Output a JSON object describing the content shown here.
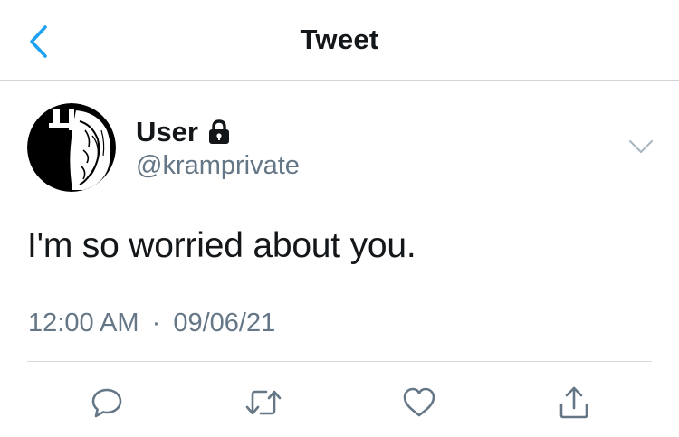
{
  "nav": {
    "title": "Tweet",
    "back_icon": "chevron-left-icon",
    "accent_color": "#1da1f2"
  },
  "tweet": {
    "author": {
      "name": "User",
      "handle": "@kramprivate",
      "protected_icon": "lock-icon",
      "avatar": "avatar-image"
    },
    "menu_icon": "chevron-down-icon",
    "text": "I'm so worried about you.",
    "time": "12:00 AM",
    "separator": "·",
    "date": "09/06/21"
  },
  "actions": [
    {
      "icon": "reply-icon"
    },
    {
      "icon": "retweet-icon"
    },
    {
      "icon": "like-icon"
    },
    {
      "icon": "share-icon"
    }
  ],
  "colors": {
    "text": "#14171a",
    "secondary": "#657786",
    "divider": "#d6d9dc",
    "icon": "#657786"
  }
}
